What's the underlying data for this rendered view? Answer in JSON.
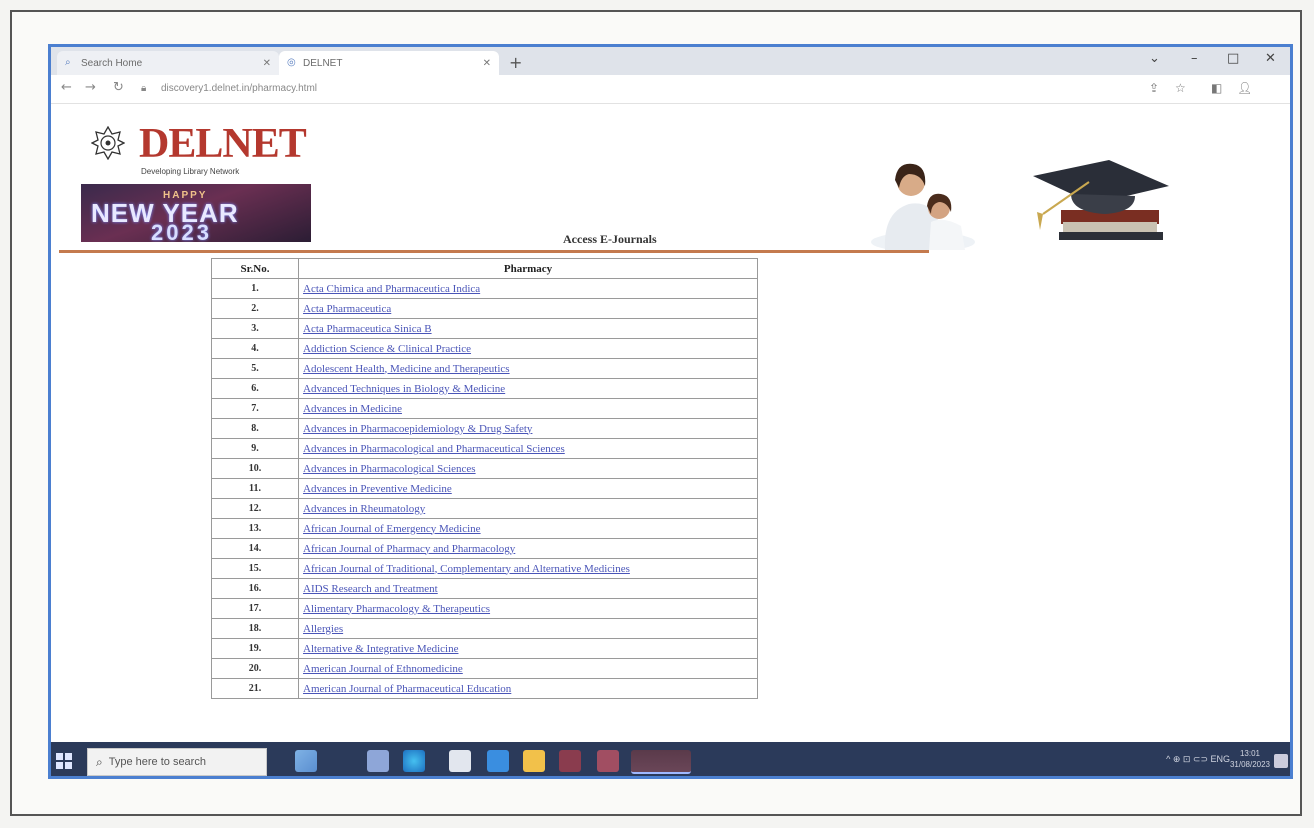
{
  "browser": {
    "tabs": [
      {
        "label": "Search Home",
        "active": false
      },
      {
        "label": "DELNET",
        "active": true
      }
    ],
    "new_tab": "+",
    "url": "discovery1.delnet.in/pharmacy.html",
    "window_controls": [
      "–",
      "□",
      "✕"
    ]
  },
  "site": {
    "logo_text": "DELNET",
    "logo_subtitle": "Developing Library Network",
    "banner": {
      "small": "HAPPY",
      "line1": "NEW YEAR",
      "line2": "2023"
    },
    "header_title": "Access E-Journals"
  },
  "table": {
    "headers": [
      "Sr.No.",
      "Pharmacy"
    ],
    "rows": [
      {
        "sno": "1.",
        "title": "Acta Chimica and Pharmaceutica Indica"
      },
      {
        "sno": "2.",
        "title": "Acta Pharmaceutica"
      },
      {
        "sno": "3.",
        "title": "Acta Pharmaceutica Sinica B"
      },
      {
        "sno": "4.",
        "title": "Addiction Science & Clinical Practice"
      },
      {
        "sno": "5.",
        "title": "Adolescent Health, Medicine and Therapeutics"
      },
      {
        "sno": "6.",
        "title": "Advanced Techniques in Biology & Medicine"
      },
      {
        "sno": "7.",
        "title": "Advances in Medicine"
      },
      {
        "sno": "8.",
        "title": "Advances in Pharmacoepidemiology & Drug Safety"
      },
      {
        "sno": "9.",
        "title": "Advances in Pharmacological and Pharmaceutical Sciences"
      },
      {
        "sno": "10.",
        "title": "Advances in Pharmacological Sciences"
      },
      {
        "sno": "11.",
        "title": "Advances in Preventive Medicine"
      },
      {
        "sno": "12.",
        "title": "Advances in Rheumatology"
      },
      {
        "sno": "13.",
        "title": "African Journal of Emergency Medicine"
      },
      {
        "sno": "14.",
        "title": "African Journal of Pharmacy and Pharmacology"
      },
      {
        "sno": "15.",
        "title": "African Journal of Traditional, Complementary and Alternative Medicines"
      },
      {
        "sno": "16.",
        "title": "AIDS Research and Treatment"
      },
      {
        "sno": "17.",
        "title": "Alimentary Pharmacology & Therapeutics"
      },
      {
        "sno": "18.",
        "title": "Allergies"
      },
      {
        "sno": "19.",
        "title": "Alternative & Integrative Medicine"
      },
      {
        "sno": "20.",
        "title": "American Journal of Ethnomedicine"
      },
      {
        "sno": "21.",
        "title": "American Journal of Pharmaceutical Education"
      }
    ]
  },
  "taskbar": {
    "search_placeholder": "Type here to search",
    "tray": "^  ⊕ ⊡ ⊂⊃  ENG",
    "clock_time": "13:01",
    "clock_date": "31/08/2023"
  },
  "colors": {
    "logo_red": "#b4382e",
    "link_blue": "#4a55b8",
    "header_rule": "#c47a4e",
    "screen_border": "#4b7fd0",
    "taskbar": "#2b3a5a"
  }
}
